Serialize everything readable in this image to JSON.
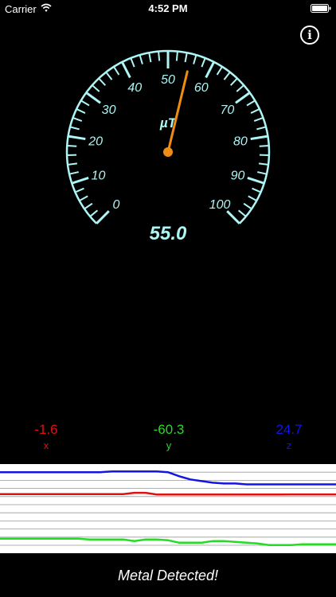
{
  "status_bar": {
    "carrier": "Carrier",
    "time": "4:52 PM"
  },
  "info_button": {
    "label": "i",
    "icon": "info-icon"
  },
  "gauge": {
    "unit": "µT",
    "min": 0,
    "max": 100,
    "tick_labels": [
      "0",
      "10",
      "20",
      "30",
      "40",
      "50",
      "60",
      "70",
      "80",
      "90",
      "100"
    ],
    "needle_value": 55.0,
    "display_value": "55.0",
    "color": "#aef5f5",
    "needle_color": "#f08c14"
  },
  "axes": {
    "x": {
      "value": "-1.6",
      "label": "x",
      "color": "#e01010"
    },
    "y": {
      "value": "-60.3",
      "label": "y",
      "color": "#22dd22"
    },
    "z": {
      "value": "24.7",
      "label": "z",
      "color": "#1515e0"
    }
  },
  "graph": {
    "series": [
      {
        "color": "#1515e0",
        "values": [
          26,
          26,
          26,
          26,
          26,
          26,
          26,
          26,
          26,
          26,
          27,
          27,
          27,
          27,
          27,
          26,
          21,
          17,
          15,
          13,
          12,
          12,
          11,
          11,
          11,
          11,
          11,
          11,
          11,
          11,
          11
        ]
      },
      {
        "color": "#e01010",
        "values": [
          -1,
          -1,
          -1,
          -1,
          -1,
          -1,
          -1,
          -1,
          -1,
          -1,
          -1,
          -1,
          0.5,
          0.5,
          -1.5,
          -1.5,
          -1.5,
          -1.5,
          -1.5,
          -1.5,
          -1.6,
          -1.6,
          -1.5,
          -1.5,
          -1.5,
          -1.5,
          -1.4,
          -1.4,
          -1.4,
          -1.4,
          -1.4
        ]
      },
      {
        "color": "#22dd22",
        "values": [
          -56,
          -56,
          -56,
          -56,
          -56,
          -56,
          -56,
          -56,
          -57,
          -57,
          -57,
          -57,
          -59,
          -57,
          -57,
          -58,
          -61,
          -61,
          -61,
          -59,
          -59,
          -60,
          -61,
          -62,
          -64,
          -64,
          -64,
          -63,
          -63,
          -63,
          -63
        ]
      }
    ]
  },
  "status_message": "Metal Detected!"
}
